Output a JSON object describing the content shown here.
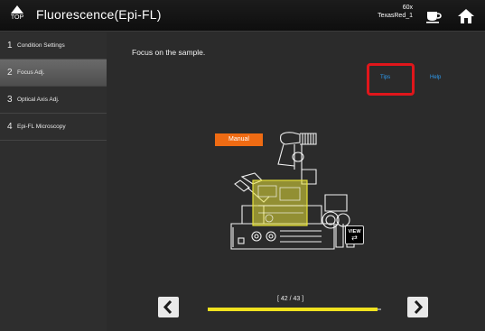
{
  "topbar": {
    "top_label": "TOP",
    "title": "Fluorescence(Epi-FL)",
    "objective": "60x",
    "filter": "TexasRed_1",
    "icons": [
      "top-arrow-icon",
      "coffee-cup-icon",
      "home-icon"
    ]
  },
  "sidebar": {
    "items": [
      {
        "num": "1",
        "label": "Condition Settings",
        "active": false
      },
      {
        "num": "2",
        "label": "Focus Adj.",
        "active": true
      },
      {
        "num": "3",
        "label": "Optical Axis Adj.",
        "active": false
      },
      {
        "num": "4",
        "label": "Epi-FL Microscopy",
        "active": false
      }
    ]
  },
  "main": {
    "instruction": "Focus on the sample.",
    "tips_label": "Tips",
    "help_label": "Help",
    "manual_label": "Manual",
    "view_label": "VIEW",
    "page_indicator": "[ 42 / 43 ]",
    "progress_fraction": 0.977
  },
  "colors": {
    "accent_orange": "#ef6b13",
    "link_blue": "#2e9cf0",
    "highlight_red": "#e0161b",
    "progress_yellow": "#f0e21f",
    "highlight_yellow": "#e7e23a"
  }
}
